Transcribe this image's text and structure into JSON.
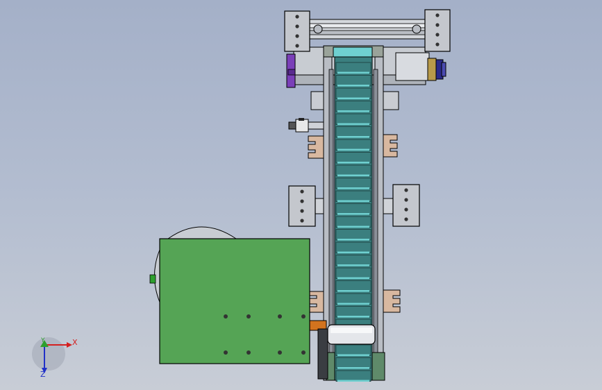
{
  "viewport": {
    "background_top": "#a4b0c8",
    "background_bottom": "#c8cdd6"
  },
  "triad": {
    "x_label": "X",
    "y_label": "Y",
    "z_label": "Z",
    "x_color": "#d42020",
    "y_color": "#2ea02e",
    "z_color": "#2030c8"
  },
  "colors": {
    "belt": "#3b7f7f",
    "belt_highlight": "#6fd0d0",
    "motor_panel": "#55a455",
    "frame_grey": "#c9ccd2",
    "rail_dark": "#8a8f98",
    "purple_part": "#7a3fb8",
    "bracket_tan": "#d8b8a0",
    "orange_part": "#d2731e"
  }
}
